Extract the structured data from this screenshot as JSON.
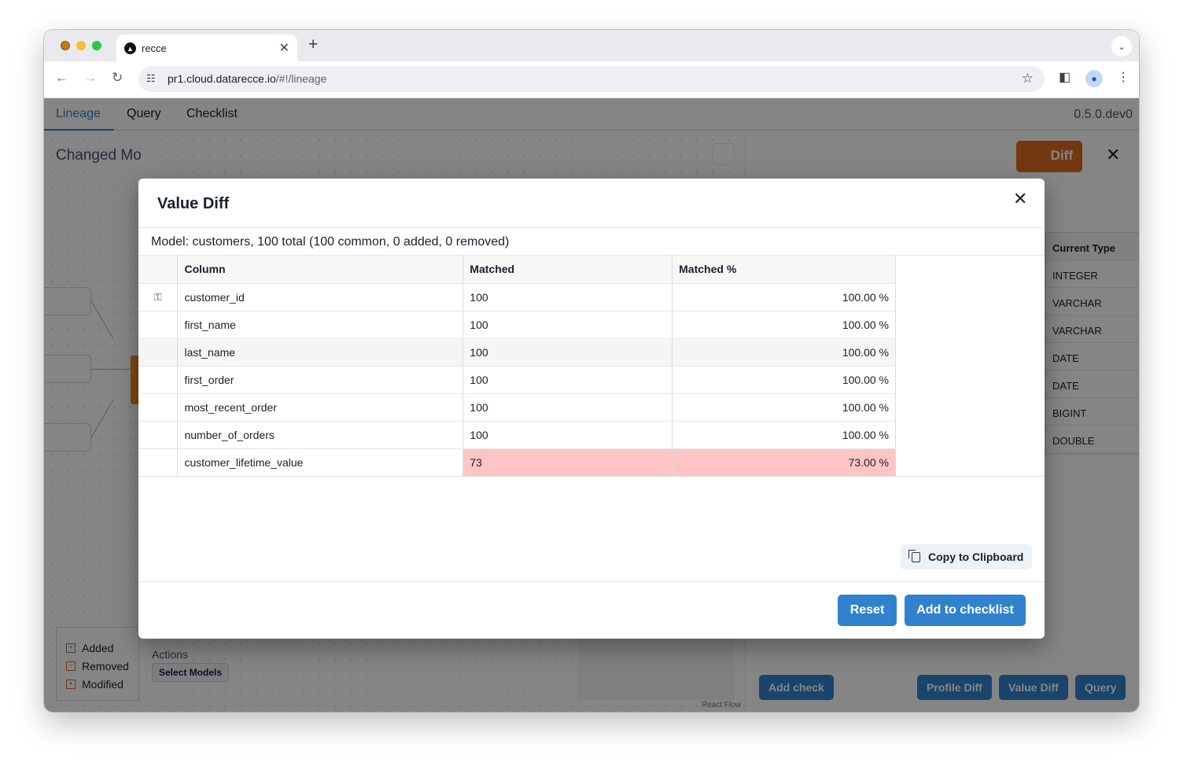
{
  "browser": {
    "tab_title": "recce",
    "url_host": "pr1.cloud.datarecce.io",
    "url_path": "/#!/lineage"
  },
  "app": {
    "tabs": [
      {
        "label": "Lineage"
      },
      {
        "label": "Query"
      },
      {
        "label": "Checklist"
      }
    ],
    "version": "0.5.0.dev0",
    "canvas_title": "Changed Mo",
    "legend": [
      {
        "label": "Added",
        "color": "#718096"
      },
      {
        "label": "Removed",
        "color": "#dd6b20"
      },
      {
        "label": "Modified",
        "color": "#dd6b20"
      }
    ],
    "actions_label": "Actions",
    "select_models": "Select Models",
    "react_flow": "React Flow"
  },
  "right_panel": {
    "orange_button": "Diff",
    "schema_header": "Current Type",
    "schema_types": [
      "INTEGER",
      "VARCHAR",
      "VARCHAR",
      "DATE",
      "DATE",
      "BIGINT",
      "DOUBLE"
    ],
    "buttons": {
      "add_check": "Add check",
      "profile_diff": "Profile Diff",
      "value_diff": "Value Diff",
      "query": "Query"
    }
  },
  "modal": {
    "title": "Value Diff",
    "summary": "Model: customers, 100 total (100 common, 0 added, 0 removed)",
    "headers": {
      "column": "Column",
      "matched": "Matched",
      "matched_pct": "Matched %"
    },
    "rows": [
      {
        "column": "customer_id",
        "matched": "100",
        "pct": "100.00 %"
      },
      {
        "column": "first_name",
        "matched": "100",
        "pct": "100.00 %"
      },
      {
        "column": "last_name",
        "matched": "100",
        "pct": "100.00 %"
      },
      {
        "column": "first_order",
        "matched": "100",
        "pct": "100.00 %"
      },
      {
        "column": "most_recent_order",
        "matched": "100",
        "pct": "100.00 %"
      },
      {
        "column": "number_of_orders",
        "matched": "100",
        "pct": "100.00 %"
      },
      {
        "column": "customer_lifetime_value",
        "matched": "73",
        "pct": "73.00 %"
      }
    ],
    "copy_button": "Copy to Clipboard",
    "reset_button": "Reset",
    "add_button": "Add to checklist"
  },
  "colors": {
    "accent": "#3182ce",
    "mismatch_bg": "#ffc5c5",
    "modified_orange": "#dd6b20"
  }
}
